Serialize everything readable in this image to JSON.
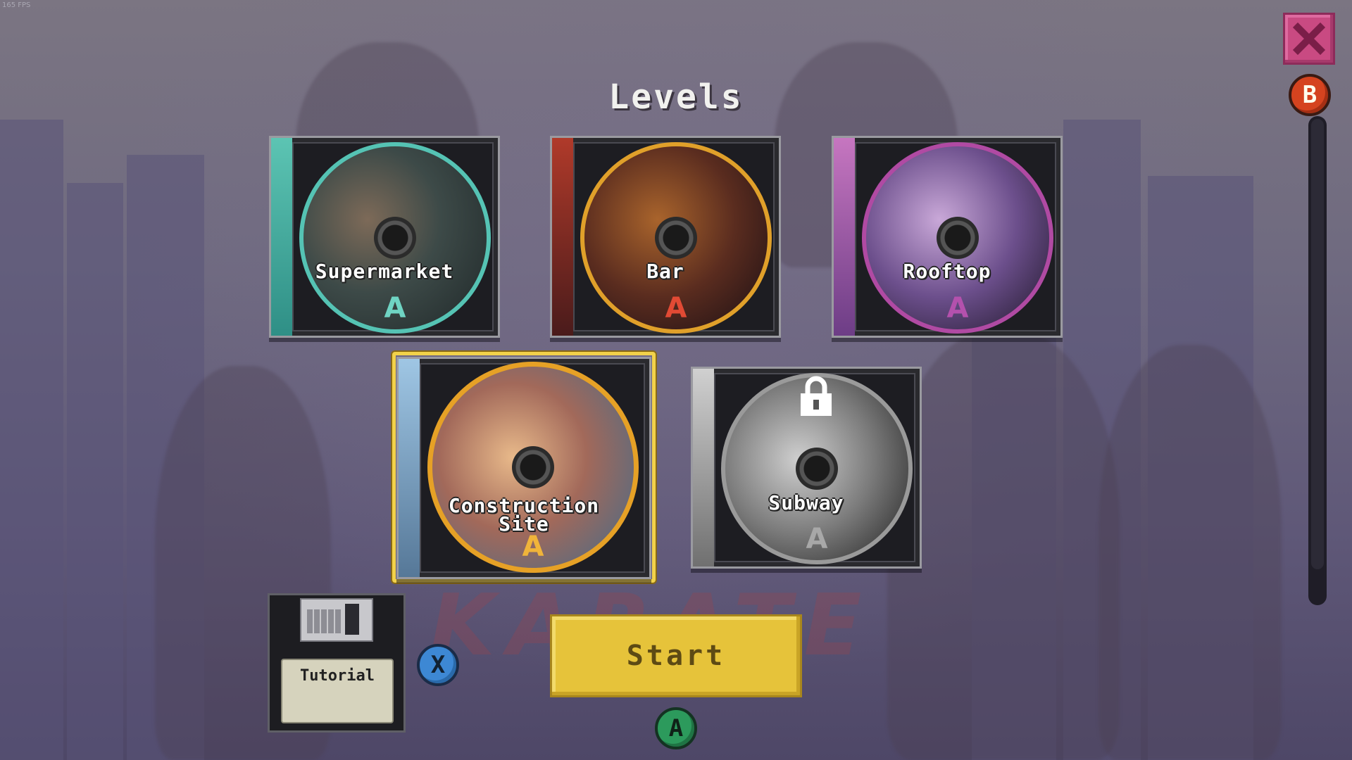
{
  "overlay": {
    "fps_text": "165 FPS"
  },
  "menu": {
    "title": "Levels",
    "close_label": "✕",
    "back_button_glyph": "B",
    "tutorial_button_glyph": "X",
    "confirm_button_glyph": "A"
  },
  "levels": [
    {
      "name": "Supermarket",
      "disc_mark": "A",
      "locked": false,
      "selected": false,
      "accent": "#3fb3a6"
    },
    {
      "name": "Bar",
      "disc_mark": "A",
      "locked": false,
      "selected": false,
      "accent": "#d2382a"
    },
    {
      "name": "Rooftop",
      "disc_mark": "A",
      "locked": false,
      "selected": false,
      "accent": "#a24a9a"
    },
    {
      "name": "Construction\nSite",
      "disc_mark": "A",
      "locked": false,
      "selected": true,
      "accent": "#e6a126"
    },
    {
      "name": "Subway",
      "disc_mark": "A",
      "locked": true,
      "selected": false,
      "accent": "#8a8a8a"
    }
  ],
  "tutorial": {
    "label": "Tutorial"
  },
  "start": {
    "label": "Start"
  },
  "colors": {
    "selection": "#f2d24a",
    "start_button": "#e6c33a",
    "close_button": "#c94a82",
    "b_button": "#d5431f",
    "x_button": "#3d88d4",
    "a_button": "#2c9a5c"
  },
  "background_logo": "KARATE"
}
